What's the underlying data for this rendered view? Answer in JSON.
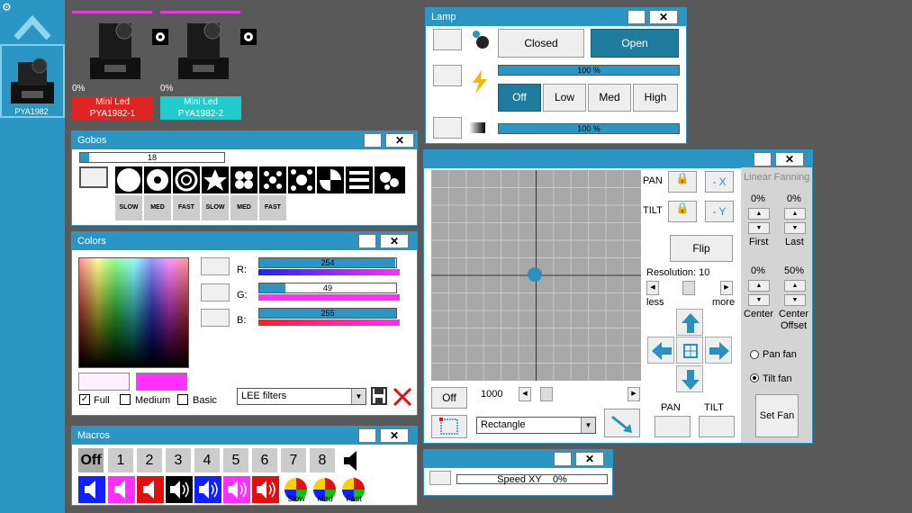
{
  "sidebar": {
    "fixture_label": "PYA1982"
  },
  "fixtures": [
    {
      "percent": "0%",
      "name": "Mini Led",
      "id": "PYA1982-1",
      "color": "#e02424"
    },
    {
      "percent": "0%",
      "name": "Mini Led",
      "id": "PYA1982-2",
      "color": "#22cccc"
    }
  ],
  "lamp": {
    "title": "Lamp",
    "closed_label": "Closed",
    "open_label": "Open",
    "intensity": "100 %",
    "intensity_value": 1.0,
    "modes": [
      "Off",
      "Low",
      "Med",
      "High"
    ],
    "dimmer": "100 %",
    "dimmer_value": 1.0
  },
  "gobos": {
    "title": "Gobos",
    "value": "18",
    "fraction": 0.06,
    "rotations": [
      "SLOW",
      "MED",
      "FAST",
      "SLOW",
      "MED",
      "FAST"
    ]
  },
  "colors": {
    "title": "Colors",
    "r_label": "R:",
    "g_label": "G:",
    "b_label": "B:",
    "r_value": "254",
    "g_value": "49",
    "b_value": "255",
    "r_fraction": 0.996,
    "g_fraction": 0.19,
    "b_fraction": 1.0,
    "current_color": "#fef1ff",
    "target_color": "#fe31ff",
    "full_label": "Full",
    "medium_label": "Medium",
    "basic_label": "Basic",
    "filter_select": "LEE filters"
  },
  "macros": {
    "title": "Macros",
    "buttons": [
      "Off",
      "1",
      "2",
      "3",
      "4",
      "5",
      "6",
      "7",
      "8"
    ],
    "speeds": [
      "Slow",
      "Med",
      "Fast"
    ]
  },
  "pantilt": {
    "pan_label": "PAN",
    "tilt_label": "TILT",
    "neg_x": "- X",
    "neg_y": "- Y",
    "flip_label": "Flip",
    "resolution_label": "Resolution: 10",
    "less_label": "less",
    "more_label": "more",
    "off_label": "Off",
    "value": "1000",
    "shape_select": "Rectangle",
    "bottom_pan": "PAN",
    "bottom_tilt": "TILT",
    "fanning": {
      "title": "Linear Fanning",
      "first_pct": "0%",
      "last_pct": "0%",
      "first_label": "First",
      "last_label": "Last",
      "center_pct": "0%",
      "offset_pct": "50%",
      "center_label": "Center",
      "offset_label_1": "Center",
      "offset_label_2": "Offset",
      "pan_fan": "Pan fan",
      "tilt_fan": "Tilt fan",
      "set_fan": "Set Fan"
    }
  },
  "speed": {
    "label": "Speed XY",
    "percent": "0%"
  }
}
